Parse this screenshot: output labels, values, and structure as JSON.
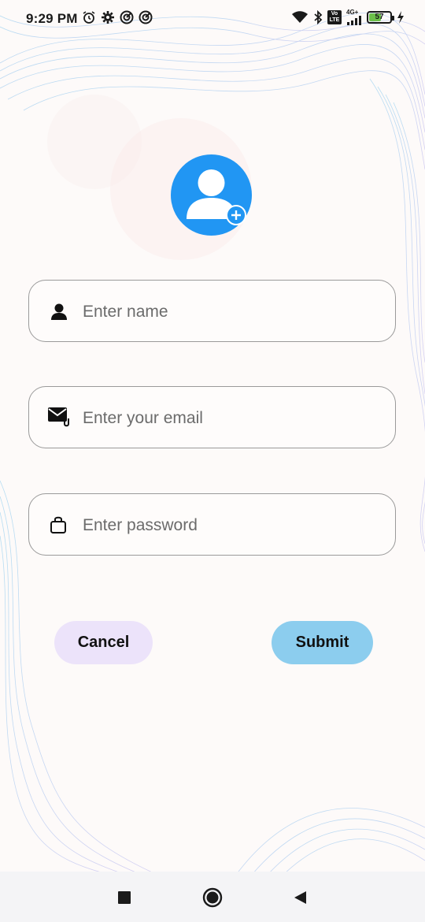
{
  "status_bar": {
    "time": "9:29 PM",
    "battery_percent": "57",
    "battery_level": 0.57,
    "network": "4G+",
    "volte": "Vo LTE"
  },
  "avatar": {
    "icon": "person-icon",
    "badge_icon": "add-circle-icon",
    "color": "#2196f3"
  },
  "form": {
    "name": {
      "placeholder": "Enter name",
      "value": "",
      "icon": "person-icon"
    },
    "email": {
      "placeholder": "Enter your email",
      "value": "",
      "icon": "email-attachment-icon"
    },
    "password": {
      "placeholder": "Enter password",
      "value": "",
      "icon": "lock-bag-icon"
    }
  },
  "buttons": {
    "cancel_label": "Cancel",
    "submit_label": "Submit"
  },
  "colors": {
    "accent": "#2196f3",
    "cancel_bg": "#ece3fa",
    "submit_bg": "#8ccdee",
    "field_border": "#9a9a9a"
  },
  "navbar": {
    "recents_icon": "square-icon",
    "home_icon": "circle-icon",
    "back_icon": "triangle-back-icon"
  }
}
